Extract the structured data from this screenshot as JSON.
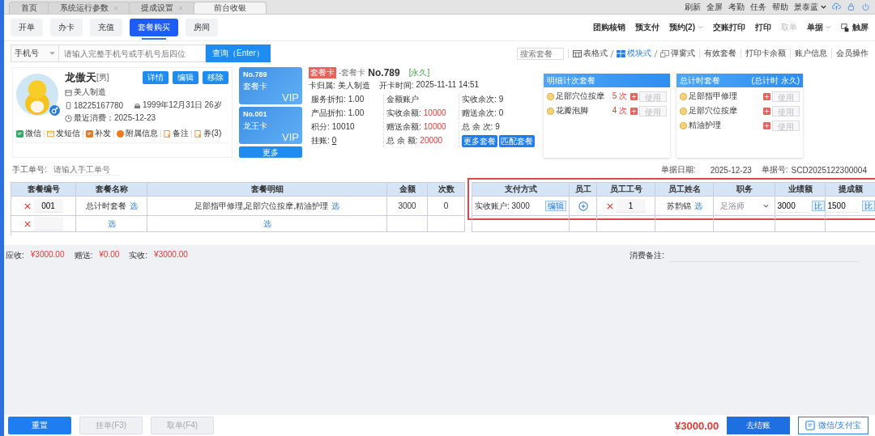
{
  "tabs": [
    {
      "label": "首页",
      "closable": false,
      "selected": false
    },
    {
      "label": "系统运行参数",
      "closable": true,
      "selected": false
    },
    {
      "label": "提成设置",
      "closable": true,
      "selected": false
    },
    {
      "label": "前台收银",
      "closable": false,
      "selected": true
    }
  ],
  "top_links": [
    "刷新",
    "全屏",
    "考勤",
    "任务",
    "帮助"
  ],
  "user": "景泰蓝",
  "actions": [
    {
      "label": "开单",
      "selected": false
    },
    {
      "label": "办卡",
      "selected": false
    },
    {
      "label": "充值",
      "selected": false
    },
    {
      "label": "套餐购买",
      "selected": true
    },
    {
      "label": "房间",
      "selected": false
    }
  ],
  "toolbar": [
    {
      "label": "团购核销",
      "kind": "link",
      "disabled": false
    },
    {
      "label": "预支付",
      "kind": "link",
      "disabled": false
    },
    {
      "label": "预约(2)",
      "kind": "dropdown",
      "disabled": false
    },
    {
      "label": "交账打印",
      "kind": "link",
      "disabled": false
    },
    {
      "label": "打印",
      "kind": "link",
      "disabled": false
    },
    {
      "label": "取单",
      "kind": "link",
      "disabled": true
    },
    {
      "label": "单据",
      "kind": "dropdown",
      "disabled": false
    },
    {
      "label": "触屏",
      "kind": "touch",
      "disabled": false
    }
  ],
  "search": {
    "field_type": "手机号",
    "placeholder": "请输入完整手机号或手机号后四位",
    "button": "查询（Enter）"
  },
  "view": {
    "placeholder": "搜索套餐",
    "modes": [
      {
        "label": "表格式",
        "kind": "table",
        "selected": false
      },
      {
        "label": "模块式",
        "kind": "blocks",
        "selected": true
      },
      {
        "label": "弹窗式",
        "kind": "popup",
        "selected": false
      }
    ],
    "links": [
      "有效套餐",
      "打印卡余额",
      "账户信息",
      "会员操作"
    ]
  },
  "member": {
    "name": "龙傲天",
    "gender": "[男]",
    "buttons": [
      "详情",
      "编辑",
      "移除"
    ],
    "store": "美人制造",
    "phone": "18225167780",
    "birthday": "1999年12月31日",
    "age": "26岁",
    "last_visit": "最近消费：2025-12-23",
    "links": [
      {
        "label": "微信",
        "kind": "wechat"
      },
      {
        "label": "发短信",
        "kind": "sms"
      },
      {
        "label": "补发",
        "kind": "reissue"
      },
      {
        "label": "附属信息",
        "kind": "info"
      },
      {
        "label": "备注",
        "kind": "note"
      },
      {
        "label": "券(3)",
        "kind": "coupon"
      }
    ]
  },
  "cards": [
    {
      "number": "No.789",
      "type": "套餐卡",
      "badge": "VIP"
    },
    {
      "number": "No.001",
      "type": "龙王卡",
      "badge": "VIP"
    }
  ],
  "more_cards": "更多",
  "card_info": {
    "tag": "套餐卡",
    "title": "-套餐卡",
    "number": "No.789",
    "validity": "[永久]",
    "owner_label": "卡归属:",
    "owner": "美人制造",
    "opened_label": "开卡时间:",
    "opened": "2025-11-11 14:51",
    "columns": [
      [
        {
          "label": "服务折扣:",
          "value": "1.00",
          "kind": "plain"
        },
        {
          "label": "产品折扣:",
          "value": "1.00",
          "kind": "plain"
        },
        {
          "label": "积分:",
          "value": "10010",
          "kind": "plain"
        },
        {
          "label": "挂账:",
          "value": "0",
          "kind": "link"
        }
      ],
      [
        {
          "label": "金额账户",
          "kind": "heading"
        },
        {
          "label": "实收余额:",
          "value": "10000",
          "kind": "money"
        },
        {
          "label": "赠送余额:",
          "value": "10000",
          "kind": "money"
        },
        {
          "label": "总 余 额:",
          "value": "20000",
          "kind": "money"
        }
      ],
      [
        {
          "label": "实收余次:",
          "value": "9",
          "kind": "plain"
        },
        {
          "label": "赠送余次:",
          "value": "0",
          "kind": "plain"
        },
        {
          "label": "总 余 次:",
          "value": "9",
          "kind": "plain"
        }
      ]
    ],
    "buttons": [
      "更多套餐",
      "匹配套餐"
    ]
  },
  "packages": [
    {
      "title": "明细计次套餐",
      "items": [
        {
          "name": "足部穴位按摩",
          "count": "5 次",
          "action": "使用",
          "disabled": true
        },
        {
          "name": "花瓣泡脚",
          "count": "4 次",
          "action": "使用",
          "disabled": true
        }
      ]
    },
    {
      "title": "总计时套餐",
      "note": "(总计时 永久)",
      "items": [
        {
          "name": "足部指甲修理",
          "action": "使用",
          "disabled": true
        },
        {
          "name": "足部穴位按摩",
          "action": "使用",
          "disabled": true
        },
        {
          "name": "精油护理",
          "action": "使用",
          "disabled": true
        }
      ]
    }
  ],
  "manual": {
    "label": "手工单号:",
    "placeholder": "请输入手工单号"
  },
  "doc": {
    "date_label": "单据日期:",
    "date": "2025-12-23",
    "no_label": "单据号:",
    "no": "SCD2025122300004"
  },
  "table": {
    "columns": [
      "套餐编号",
      "套餐名称",
      "套餐明细",
      "金额",
      "次数",
      "支付方式",
      "员工",
      "员工工号",
      "员工姓名",
      "职务",
      "业绩额",
      "提成额"
    ],
    "rows": [
      {
        "code": "001",
        "name": "总计时套餐",
        "pick_name": "选",
        "detail": "足部指甲修理,足部穴位按摩,精油护理",
        "pick_detail": "选",
        "amount": "3000",
        "times": "0",
        "staff": {
          "payment": "实收账户: 3000",
          "edit": "编辑",
          "number": "1",
          "name": "苏韵锦",
          "pick": "选",
          "role": "足浴师",
          "performance": "3000",
          "ratio": "比",
          "commission": "1500",
          "ratio2": "比"
        }
      },
      {
        "pick_name": "选",
        "pick_detail": "选"
      }
    ]
  },
  "totals": [
    {
      "label": "应收:",
      "value": "¥3000.00"
    },
    {
      "label": "赠送:",
      "value": "¥0.00"
    },
    {
      "label": "实收:",
      "value": "¥3000.00"
    }
  ],
  "remark_label": "消费备注:",
  "footer": {
    "buttons": [
      {
        "label": "重置",
        "disabled": false
      },
      {
        "label": "挂单(F3)",
        "disabled": true
      },
      {
        "label": "取单(F4)",
        "disabled": true
      }
    ],
    "total": "¥3000.00",
    "checkout": "去结账",
    "pay": "微信/支付宝"
  }
}
